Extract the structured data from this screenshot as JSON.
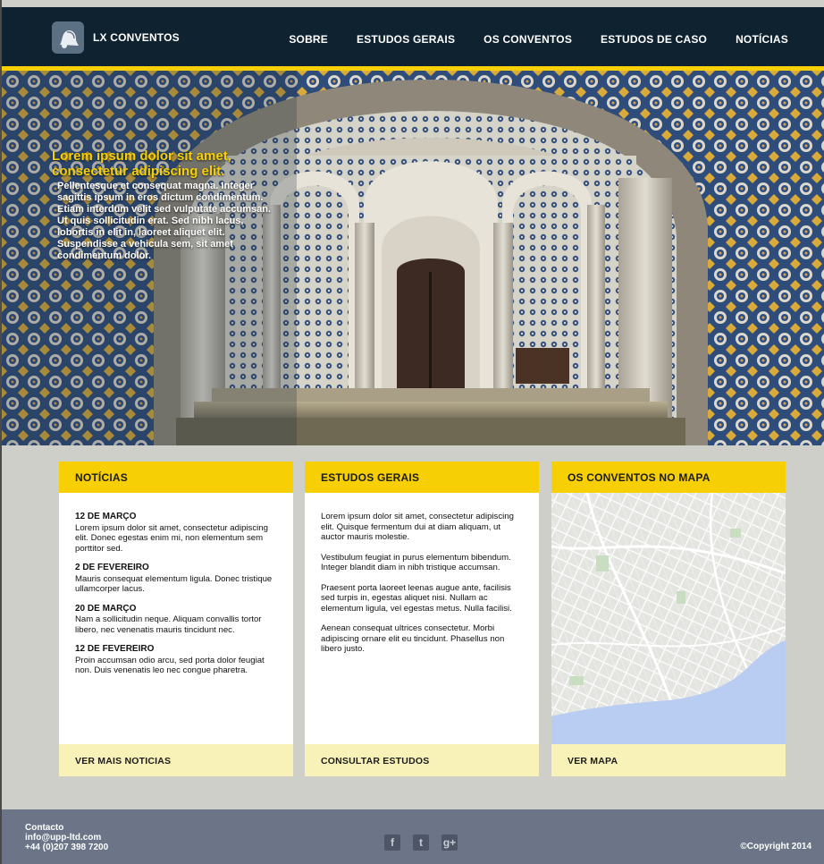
{
  "header": {
    "logo_text": "LX CONVENTOS",
    "nav": [
      "SOBRE",
      "ESTUDOS GERAIS",
      "OS CONVENTOS",
      "ESTUDOS DE CASO",
      "NOTÍCIAS"
    ]
  },
  "hero": {
    "title": "Lorem ipsum dolor sit amet, consectetur adipiscing elit.",
    "body": "Pellentesque et consequat magna. Integer sagittis ipsum in eros dictum condimentum. Etiam interdum velit sed vulputate accumsan. Ut quis sollicitudin erat. Sed nibh lacus, lobortis in elit in, laoreet aliquet elit. Suspendisse a vehicula sem, sit amet condimentum dolor."
  },
  "cards": {
    "news": {
      "title": "NOTÍCIAS",
      "items": [
        {
          "date": "12 DE MARÇO",
          "text": "Lorem ipsum dolor sit amet, consectetur adipiscing elit. Donec egestas enim mi, non elementum sem porttitor sed."
        },
        {
          "date": "2 DE FEVEREIRO",
          "text": "Mauris consequat elementum ligula. Donec tristique ullamcorper lacus."
        },
        {
          "date": "20 DE MARÇO",
          "text": "Nam a sollicitudin neque. Aliquam convallis tortor libero, nec venenatis mauris tincidunt nec."
        },
        {
          "date": "12 DE FEVEREIRO",
          "text": "Proin accumsan odio arcu, sed porta dolor feugiat non. Duis venenatis leo nec congue pharetra."
        }
      ],
      "footer": "VER MAIS NOTICIAS"
    },
    "studies": {
      "title": "ESTUDOS GERAIS",
      "paragraphs": [
        "Lorem ipsum dolor sit amet, consectetur adipiscing elit. Quisque fermentum dui at diam aliquam, ut auctor mauris molestie.",
        "Vestibulum feugiat in purus elementum bibendum. Integer blandit diam in nibh tristique accumsan.",
        "Praesent porta laoreet leenas augue ante, facilisis sed turpis in, egestas aliquet nisi. Nullam ac elementum ligula, vel egestas metus. Nulla facilisi.",
        "Aenean consequat ultrices consectetur. Morbi adipiscing ornare elit eu tincidunt. Phasellus non libero justo."
      ],
      "footer": "CONSULTAR ESTUDOS"
    },
    "map": {
      "title": "OS CONVENTOS NO MAPA",
      "footer": "VER MAPA"
    }
  },
  "footer": {
    "contact_label": "Contacto",
    "email": "info@upp-ltd.com",
    "phone": "+44 (0)207 398 7200",
    "social": [
      {
        "icon": "facebook-icon",
        "glyph": "f"
      },
      {
        "icon": "twitter-icon",
        "glyph": "t"
      },
      {
        "icon": "google-plus-icon",
        "glyph": "g+"
      }
    ],
    "copyright": "©Copyright 2014"
  },
  "colors": {
    "header_bg": "#0f2230",
    "accent": "#f7cf05",
    "card_footer": "#f8f2b8",
    "page_bg": "#cfcfca",
    "footer_bg": "#6b7587"
  }
}
